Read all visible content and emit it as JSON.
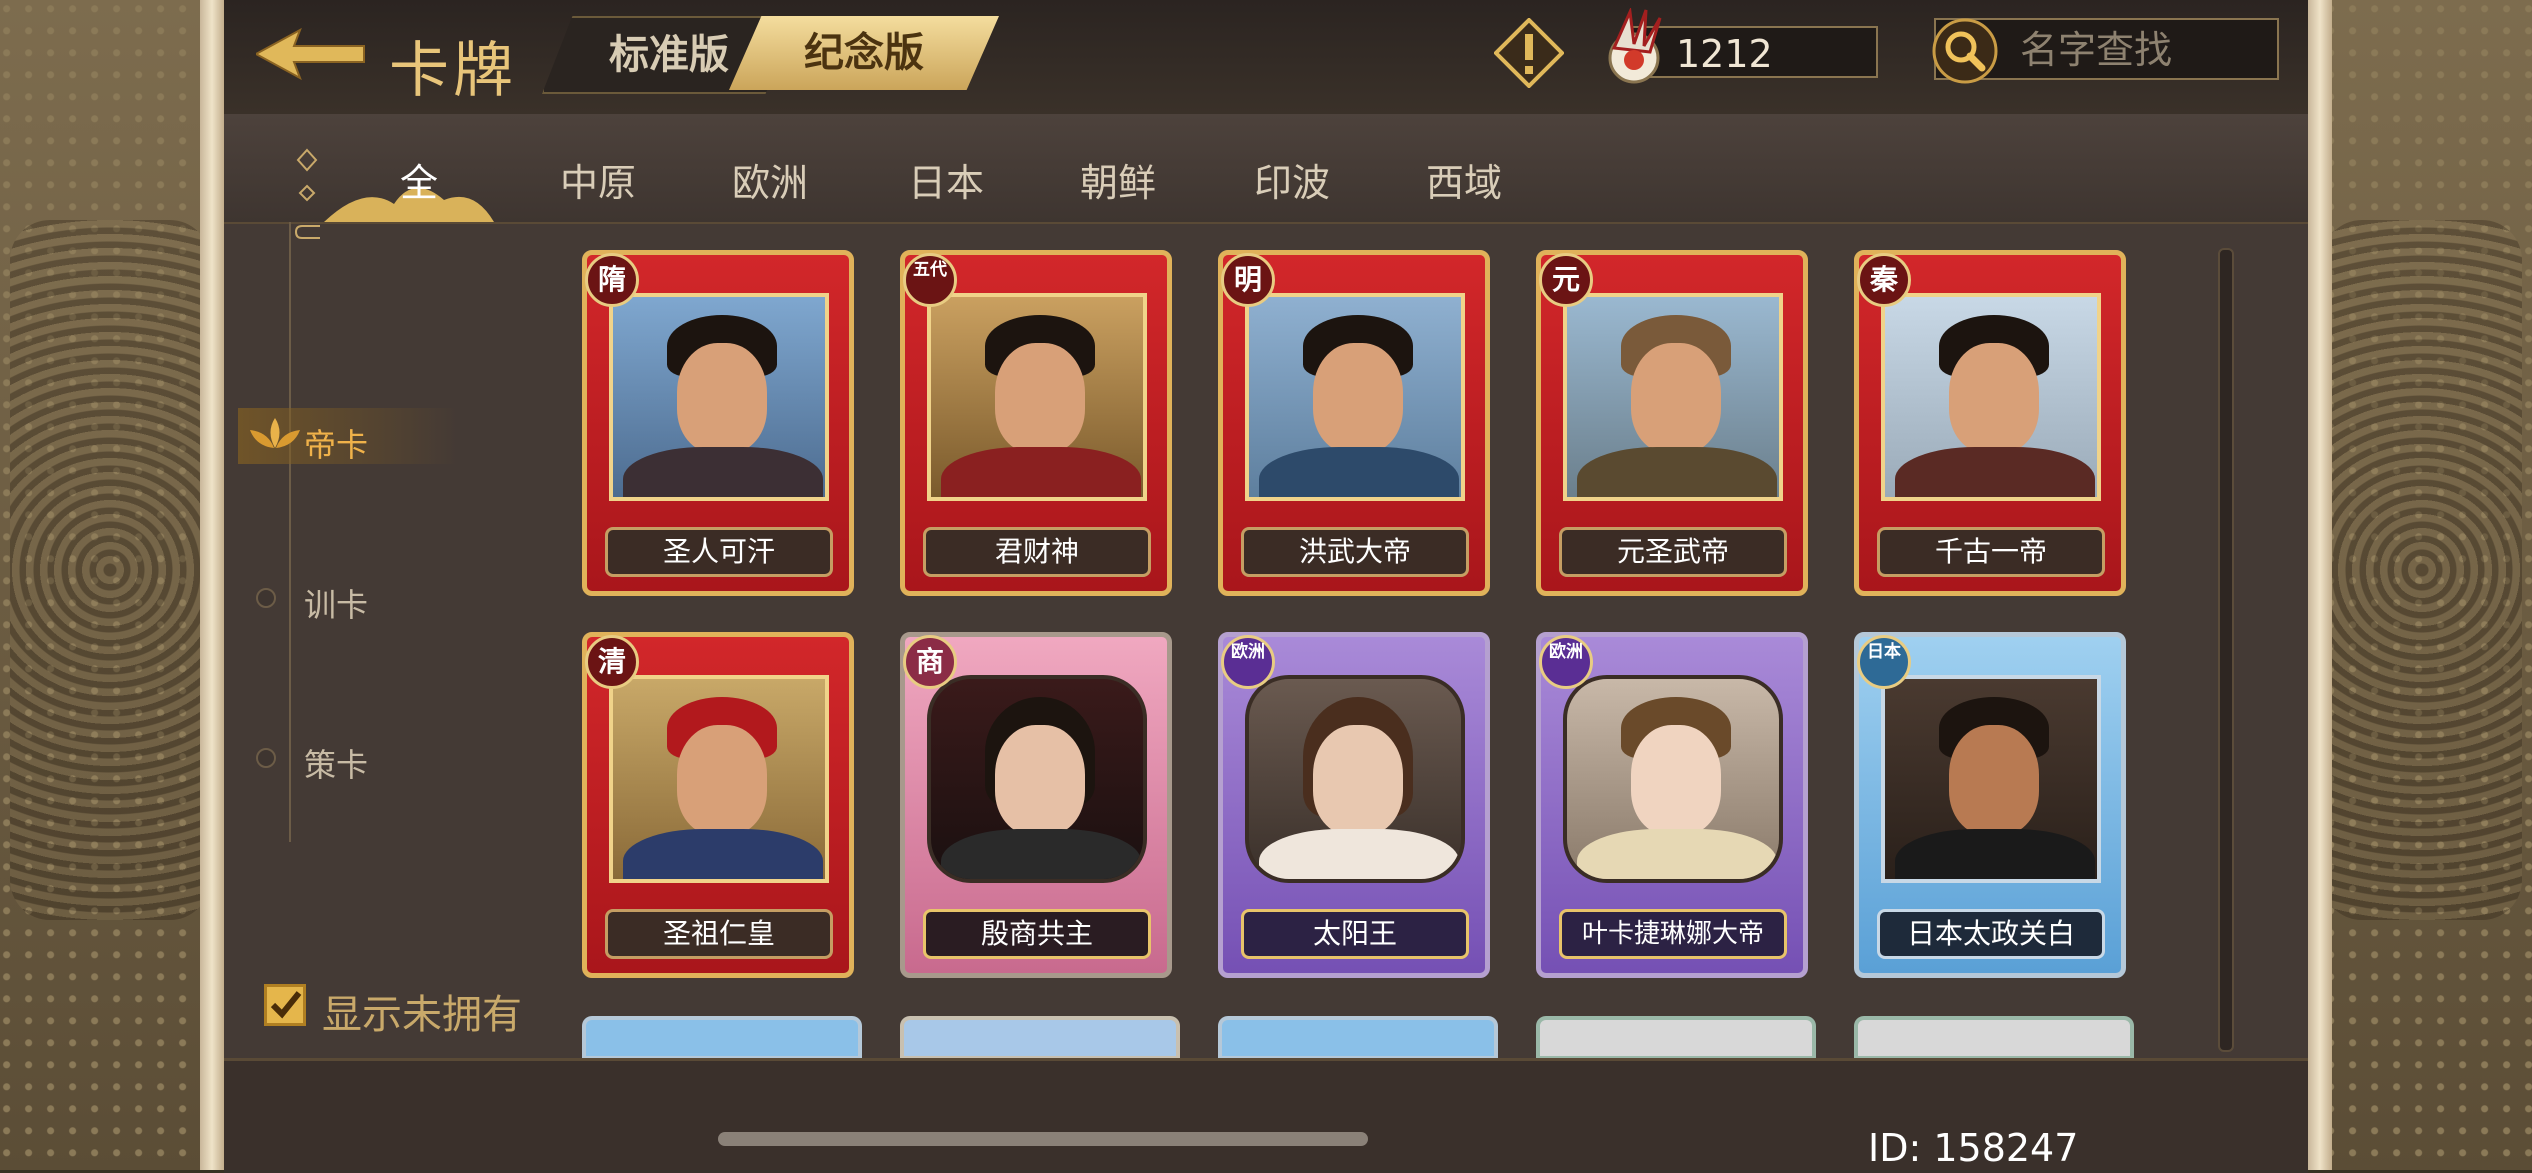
{
  "header": {
    "title": "卡牌",
    "version_tabs": [
      {
        "label": "标准版",
        "active": false
      },
      {
        "label": "纪念版",
        "active": true
      }
    ],
    "currency_value": "1212",
    "search_placeholder": "名字查找"
  },
  "filter_tabs": [
    {
      "label": "全",
      "active": true
    },
    {
      "label": "中原"
    },
    {
      "label": "欧洲"
    },
    {
      "label": "日本"
    },
    {
      "label": "朝鲜"
    },
    {
      "label": "印波"
    },
    {
      "label": "西域"
    }
  ],
  "categories": [
    {
      "label": "帝卡",
      "active": true
    },
    {
      "label": "训卡"
    },
    {
      "label": "策卡"
    }
  ],
  "show_unowned": {
    "label": "显示未拥有",
    "checked": true
  },
  "cards": [
    {
      "name": "圣人可汗",
      "badge": "隋",
      "style": "red"
    },
    {
      "name": "君财神",
      "badge": "五代",
      "style": "red"
    },
    {
      "name": "洪武大帝",
      "badge": "明",
      "style": "red"
    },
    {
      "name": "元圣武帝",
      "badge": "元",
      "style": "red"
    },
    {
      "name": "千古一帝",
      "badge": "秦",
      "style": "red"
    },
    {
      "name": "圣祖仁皇",
      "badge": "清",
      "style": "red"
    },
    {
      "name": "殷商共主",
      "badge": "商",
      "style": "pink"
    },
    {
      "name": "太阳王",
      "badge": "欧洲",
      "style": "purple"
    },
    {
      "name": "叶卡捷琳娜大帝",
      "badge": "欧洲",
      "style": "purple"
    },
    {
      "name": "日本太政关白",
      "badge": "日本",
      "style": "blue"
    }
  ],
  "colors": {
    "accent_gold": "#e8c57a",
    "active_category": "#f0b24a",
    "panel_bg": "#443a35"
  },
  "footer": {
    "user_id": "ID: 158247"
  }
}
